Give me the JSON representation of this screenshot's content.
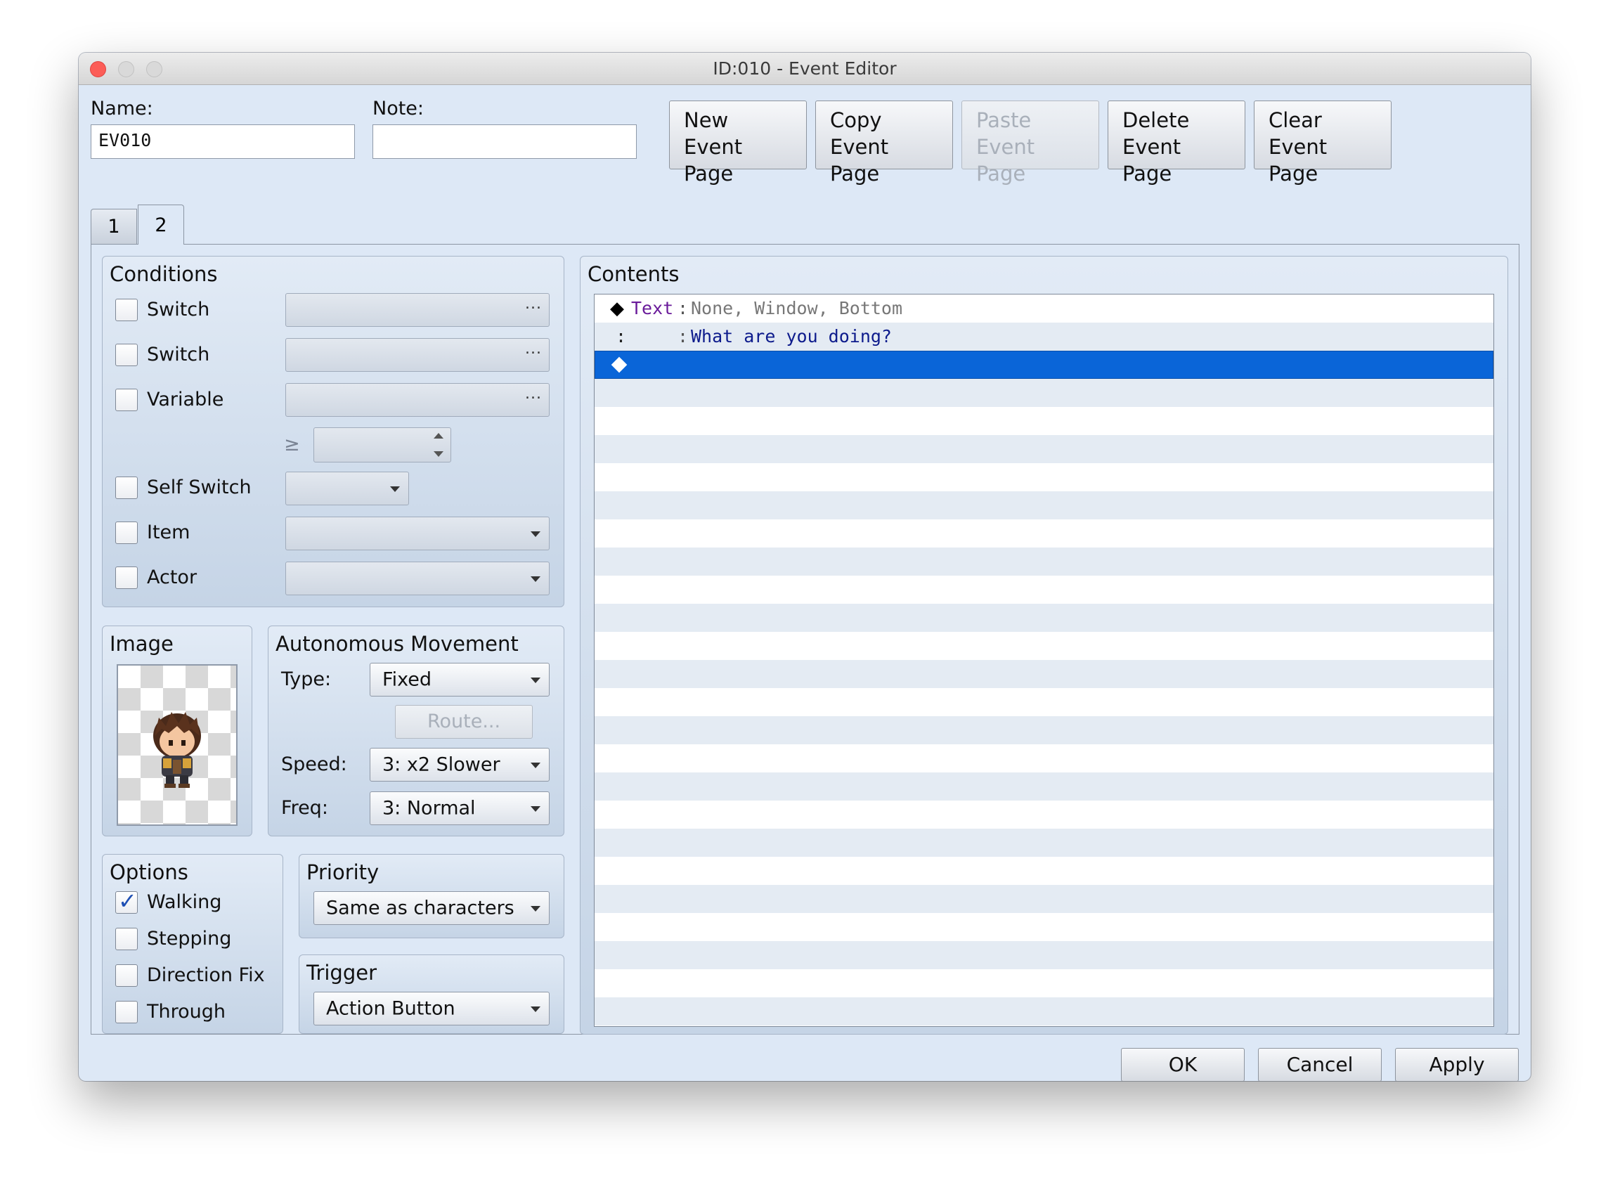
{
  "window": {
    "title": "ID:010 - Event Editor"
  },
  "header": {
    "name_label": "Name:",
    "name_value": "EV010",
    "note_label": "Note:",
    "note_value": "",
    "buttons": [
      {
        "line1": "New",
        "line2": "Event Page",
        "enabled": true
      },
      {
        "line1": "Copy",
        "line2": "Event Page",
        "enabled": true
      },
      {
        "line1": "Paste",
        "line2": "Event Page",
        "enabled": false
      },
      {
        "line1": "Delete",
        "line2": "Event Page",
        "enabled": true
      },
      {
        "line1": "Clear",
        "line2": "Event Page",
        "enabled": true
      }
    ]
  },
  "tabs": [
    {
      "label": "1",
      "active": false
    },
    {
      "label": "2",
      "active": true
    }
  ],
  "conditions": {
    "title": "Conditions",
    "switch1": {
      "label": "Switch",
      "checked": false,
      "dots": "..."
    },
    "switch2": {
      "label": "Switch",
      "checked": false,
      "dots": "..."
    },
    "variable": {
      "label": "Variable",
      "checked": false,
      "dots": "...",
      "compare": "≥",
      "value": ""
    },
    "self_switch": {
      "label": "Self Switch",
      "checked": false,
      "value": ""
    },
    "item": {
      "label": "Item",
      "checked": false,
      "value": ""
    },
    "actor": {
      "label": "Actor",
      "checked": false,
      "value": ""
    }
  },
  "image": {
    "title": "Image",
    "sprite": "character-sprite-brown-hair-armor"
  },
  "autonomous_movement": {
    "title": "Autonomous Movement",
    "type_label": "Type:",
    "type_value": "Fixed",
    "route_label": "Route...",
    "speed_label": "Speed:",
    "speed_value": "3: x2 Slower",
    "freq_label": "Freq:",
    "freq_value": "3: Normal"
  },
  "options": {
    "title": "Options",
    "items": [
      {
        "label": "Walking",
        "checked": true
      },
      {
        "label": "Stepping",
        "checked": false
      },
      {
        "label": "Direction Fix",
        "checked": false
      },
      {
        "label": "Through",
        "checked": false
      }
    ]
  },
  "priority": {
    "title": "Priority",
    "value": "Same as characters"
  },
  "trigger": {
    "title": "Trigger",
    "value": "Action Button"
  },
  "contents": {
    "title": "Contents",
    "rows": [
      {
        "marker": "◆",
        "command": "Text",
        "sep": ":",
        "args": "None, Window, Bottom"
      },
      {
        "marker": ":",
        "command": "",
        "sep": ":",
        "args": "What are you doing?"
      },
      {
        "marker": "◆",
        "command": "",
        "sep": "",
        "args": "",
        "selected": true
      }
    ]
  },
  "footer": {
    "ok": "OK",
    "cancel": "Cancel",
    "apply": "Apply"
  },
  "colors": {
    "selection": "#0a65d8",
    "command": "#6a1b9a",
    "message_text": "#0d1b8c",
    "args_gray": "#777777"
  }
}
